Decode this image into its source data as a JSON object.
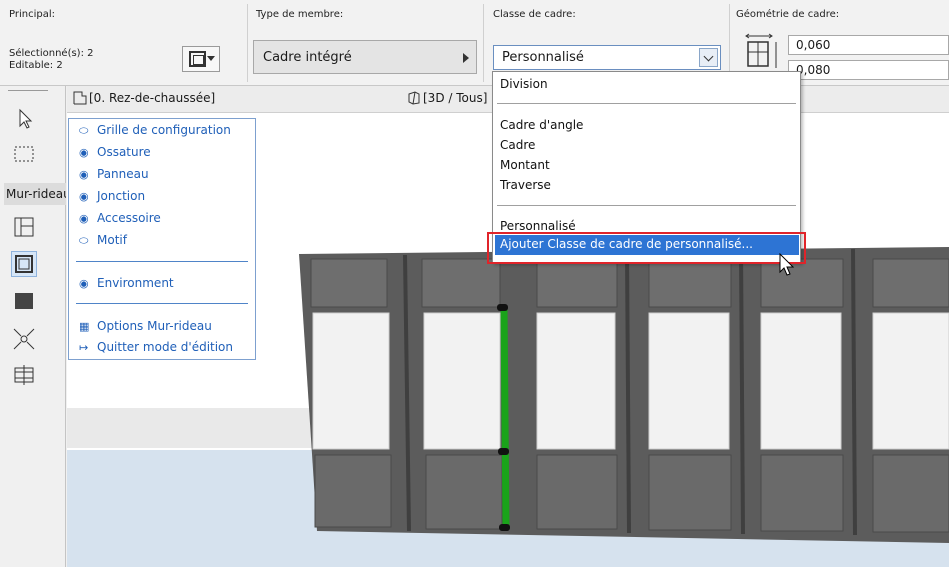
{
  "infobox": {
    "principal_label": "Principal:",
    "selected_text": "Sélectionné(s): 2",
    "editable_text": "Editable: 2",
    "member_type_label": "Type de membre:",
    "member_type_value": "Cadre intégré",
    "frame_class_label": "Classe de cadre:",
    "frame_class_value": "Personnalisé",
    "geometry_label": "Géométrie de cadre:",
    "geometry_width": "0,060",
    "geometry_depth": "0,080"
  },
  "toolbox": {
    "mode_label": "Mur-rideau"
  },
  "tabs": {
    "floor_plan": "[0. Rez-de-chaussée]",
    "view_3d": "[3D / Tous]"
  },
  "navigator": {
    "items": [
      {
        "label": "Grille de configuration",
        "icon": "eye-closed-icon"
      },
      {
        "label": "Ossature",
        "icon": "eye-icon"
      },
      {
        "label": "Panneau",
        "icon": "eye-icon"
      },
      {
        "label": "Jonction",
        "icon": "eye-icon"
      },
      {
        "label": "Accessoire",
        "icon": "eye-icon"
      },
      {
        "label": "Motif",
        "icon": "eye-closed-icon"
      }
    ],
    "environment_label": "Environment",
    "options_label": "Options Mur-rideau",
    "quit_label": "Quitter mode d'édition"
  },
  "dropdown": {
    "division": "Division",
    "corner_frame": "Cadre d'angle",
    "frame": "Cadre",
    "mullion": "Montant",
    "transom": "Traverse",
    "custom": "Personnalisé",
    "add_custom": "Ajouter Classe de cadre de personnalisé..."
  },
  "colors": {
    "highlight": "#2d74d4",
    "callout_red": "#e0242a",
    "selected_frame": "#1aa31a",
    "wall_panel": "#5f5f5f",
    "glass": "#f2f2f2"
  }
}
